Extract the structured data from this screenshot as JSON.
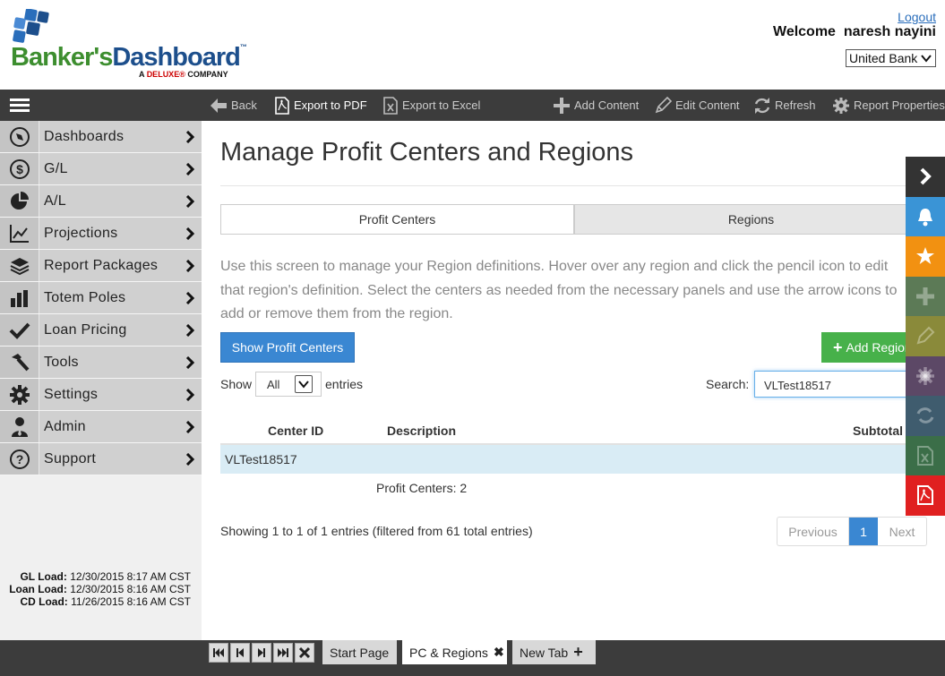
{
  "header": {
    "logo_part1": "Banker's",
    "logo_part2": "Dashboard",
    "logo_tm": "™",
    "logo_sub_prefix": "A",
    "logo_sub_brand": "DELUXE®",
    "logo_sub_suffix": "COMPANY",
    "logout": "Logout",
    "welcome": "Welcome  naresh nayini",
    "bank": "United Bank"
  },
  "toolbar": {
    "back": "Back",
    "export_pdf": "Export to PDF",
    "export_excel": "Export to Excel",
    "add_content": "Add Content",
    "edit_content": "Edit Content",
    "refresh": "Refresh",
    "report_properties": "Report Properties"
  },
  "sidebar": {
    "items": [
      {
        "label": "Dashboards",
        "icon": "compass-icon"
      },
      {
        "label": "G/L",
        "icon": "dollar-icon"
      },
      {
        "label": "A/L",
        "icon": "pie-icon"
      },
      {
        "label": "Projections",
        "icon": "line-chart-icon"
      },
      {
        "label": "Report Packages",
        "icon": "layers-icon"
      },
      {
        "label": "Totem Poles",
        "icon": "bar-chart-icon"
      },
      {
        "label": "Loan Pricing",
        "icon": "check-icon"
      },
      {
        "label": "Tools",
        "icon": "hammer-icon"
      },
      {
        "label": "Settings",
        "icon": "gear-icon"
      },
      {
        "label": "Admin",
        "icon": "user-tie-icon"
      },
      {
        "label": "Support",
        "icon": "question-icon"
      }
    ],
    "loads": {
      "gl_label": "GL Load:",
      "gl_value": "12/30/2015 8:17 AM CST",
      "loan_label": "Loan Load:",
      "loan_value": "12/30/2015 8:16 AM CST",
      "cd_label": "CD Load:",
      "cd_value": "11/26/2015 8:16 AM CST"
    }
  },
  "main": {
    "title": "Manage Profit Centers and Regions",
    "tabs": [
      {
        "label": "Profit Centers",
        "active": true
      },
      {
        "label": "Regions",
        "active": false
      }
    ],
    "intro": "Use this screen to manage your Region definitions. Hover over any region and click the pencil icon to edit that region's definition. Select the centers as needed from the necessary panels and use the arrow icons to add or remove them from the region.",
    "show_profit_centers": "Show Profit Centers",
    "add_region": "Add Region",
    "show_label": "Show",
    "show_value": "All",
    "entries_label": "entries",
    "search_label": "Search:",
    "search_value": "VLTest18517",
    "columns": {
      "center_id": "Center ID",
      "description": "Description",
      "subtotal": "Subtotal"
    },
    "rows": [
      {
        "center_id": "VLTest18517",
        "description": "",
        "subtotal": ""
      }
    ],
    "pc_count": "Profit Centers: 2",
    "showing": "Showing 1 to 1 of 1 entries (filtered from 61 total entries)",
    "pager": {
      "previous": "Previous",
      "current": "1",
      "next": "Next"
    }
  },
  "quickbar": {
    "items": [
      {
        "icon": "chevron-right-icon",
        "color": "#333333"
      },
      {
        "icon": "bell-icon",
        "color": "#3a94d6"
      },
      {
        "icon": "star-icon",
        "color": "#f29111"
      },
      {
        "icon": "plus-icon",
        "color": "#5c7a56"
      },
      {
        "icon": "pencil-icon",
        "color": "#8a8a3a"
      },
      {
        "icon": "gear-icon",
        "color": "#5c4866"
      },
      {
        "icon": "refresh-icon",
        "color": "#3f5c6e"
      },
      {
        "icon": "excel-icon",
        "color": "#3b6e48"
      },
      {
        "icon": "pdf-icon",
        "color": "#e02020"
      }
    ]
  },
  "bottom": {
    "tabs": [
      {
        "label": "Start Page"
      },
      {
        "label": "PC & Regions"
      },
      {
        "label": "New Tab"
      }
    ]
  },
  "colors": {
    "accent_blue": "#3a87d2",
    "green": "#47b14a",
    "toolbar": "#3c3c3c",
    "row_highlight": "#d9ecf5"
  }
}
